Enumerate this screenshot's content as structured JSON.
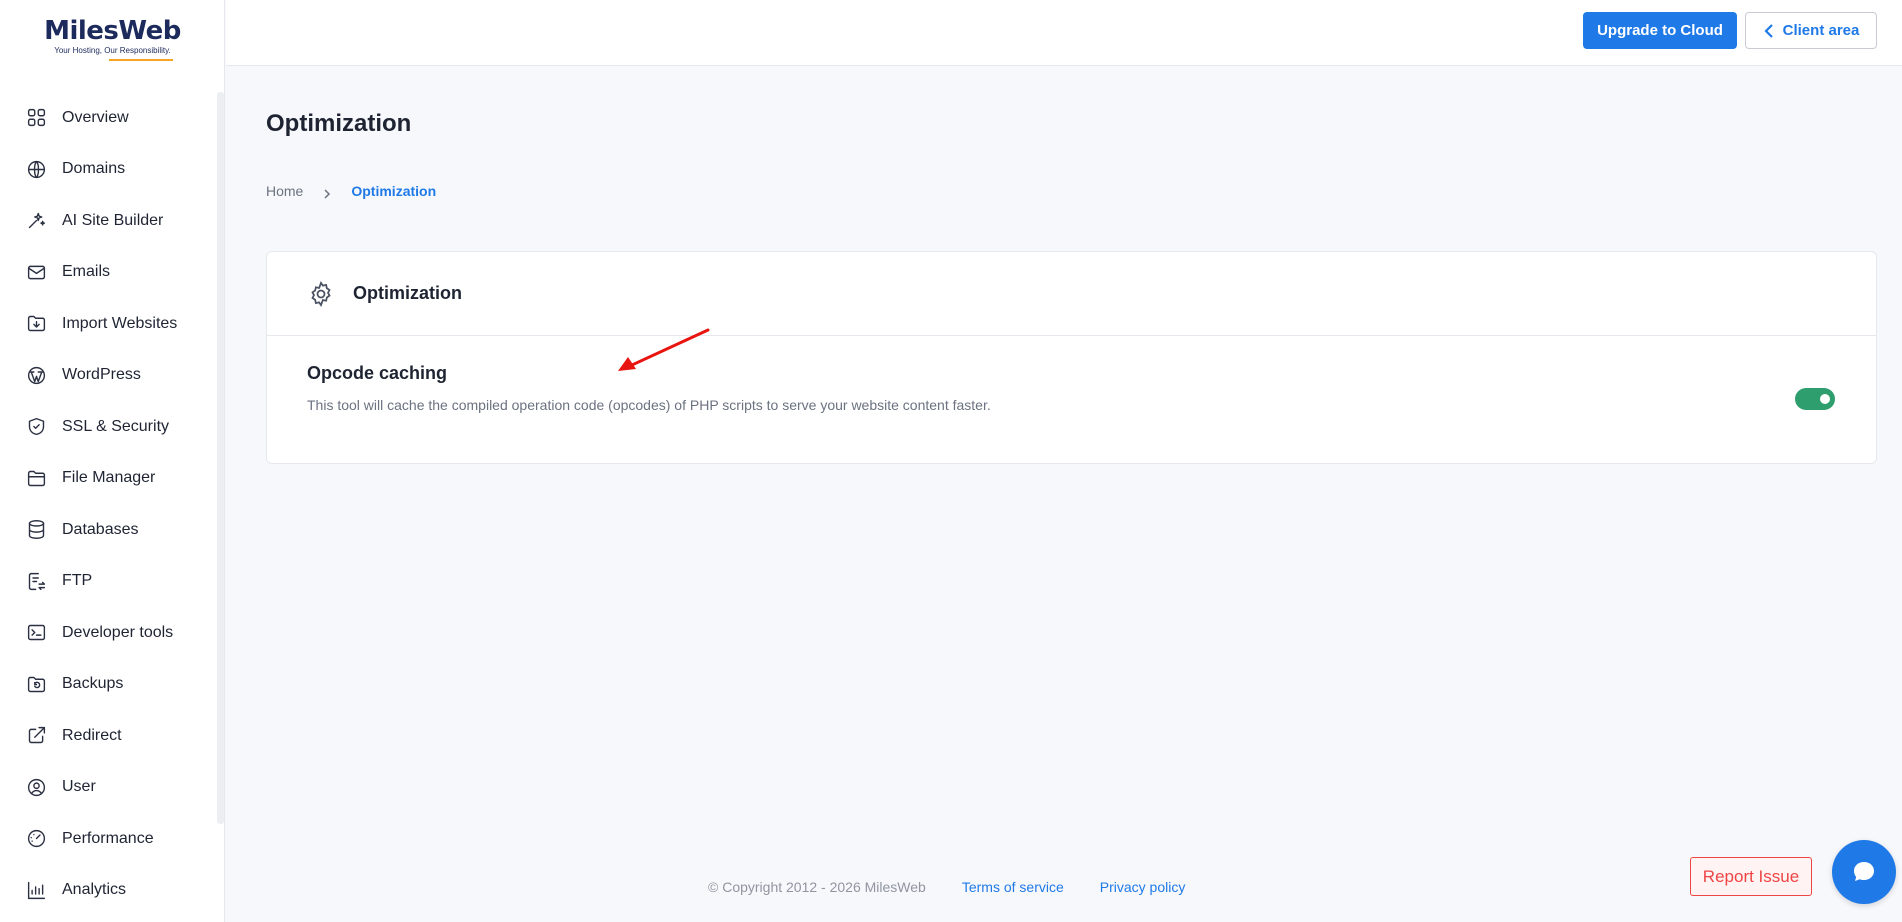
{
  "brand": {
    "name": "MilesWeb",
    "tagline": "Your Hosting, Our Responsibility."
  },
  "colors": {
    "accent": "#1f7ae8",
    "toggle_on": "#2e9e6e",
    "danger": "#ef4444"
  },
  "sidebar": {
    "items": [
      {
        "label": "Overview",
        "icon": "overview-icon"
      },
      {
        "label": "Domains",
        "icon": "globe-icon"
      },
      {
        "label": "AI Site Builder",
        "icon": "sparkle-icon"
      },
      {
        "label": "Emails",
        "icon": "mail-icon"
      },
      {
        "label": "Import Websites",
        "icon": "import-icon"
      },
      {
        "label": "WordPress",
        "icon": "wordpress-icon"
      },
      {
        "label": "SSL & Security",
        "icon": "shield-icon"
      },
      {
        "label": "File Manager",
        "icon": "folder-icon"
      },
      {
        "label": "Databases",
        "icon": "database-icon"
      },
      {
        "label": "FTP",
        "icon": "ftp-icon"
      },
      {
        "label": "Developer tools",
        "icon": "terminal-icon"
      },
      {
        "label": "Backups",
        "icon": "backup-icon"
      },
      {
        "label": "Redirect",
        "icon": "redirect-icon"
      },
      {
        "label": "User",
        "icon": "user-icon"
      },
      {
        "label": "Performance",
        "icon": "gauge-icon"
      },
      {
        "label": "Analytics",
        "icon": "chart-icon"
      }
    ]
  },
  "topbar": {
    "upgrade_label": "Upgrade to Cloud",
    "client_label": "Client area"
  },
  "page": {
    "title": "Optimization",
    "breadcrumb": {
      "home": "Home",
      "current": "Optimization"
    }
  },
  "card": {
    "title": "Optimization",
    "setting_title": "Opcode caching",
    "setting_desc": "This tool will cache the compiled operation code (opcodes) of PHP scripts to serve your website content faster.",
    "enabled": true
  },
  "footer": {
    "copyright": "© Copyright 2012 - 2026 MilesWeb",
    "terms": "Terms of service",
    "privacy": "Privacy policy"
  },
  "report_label": "Report Issue"
}
